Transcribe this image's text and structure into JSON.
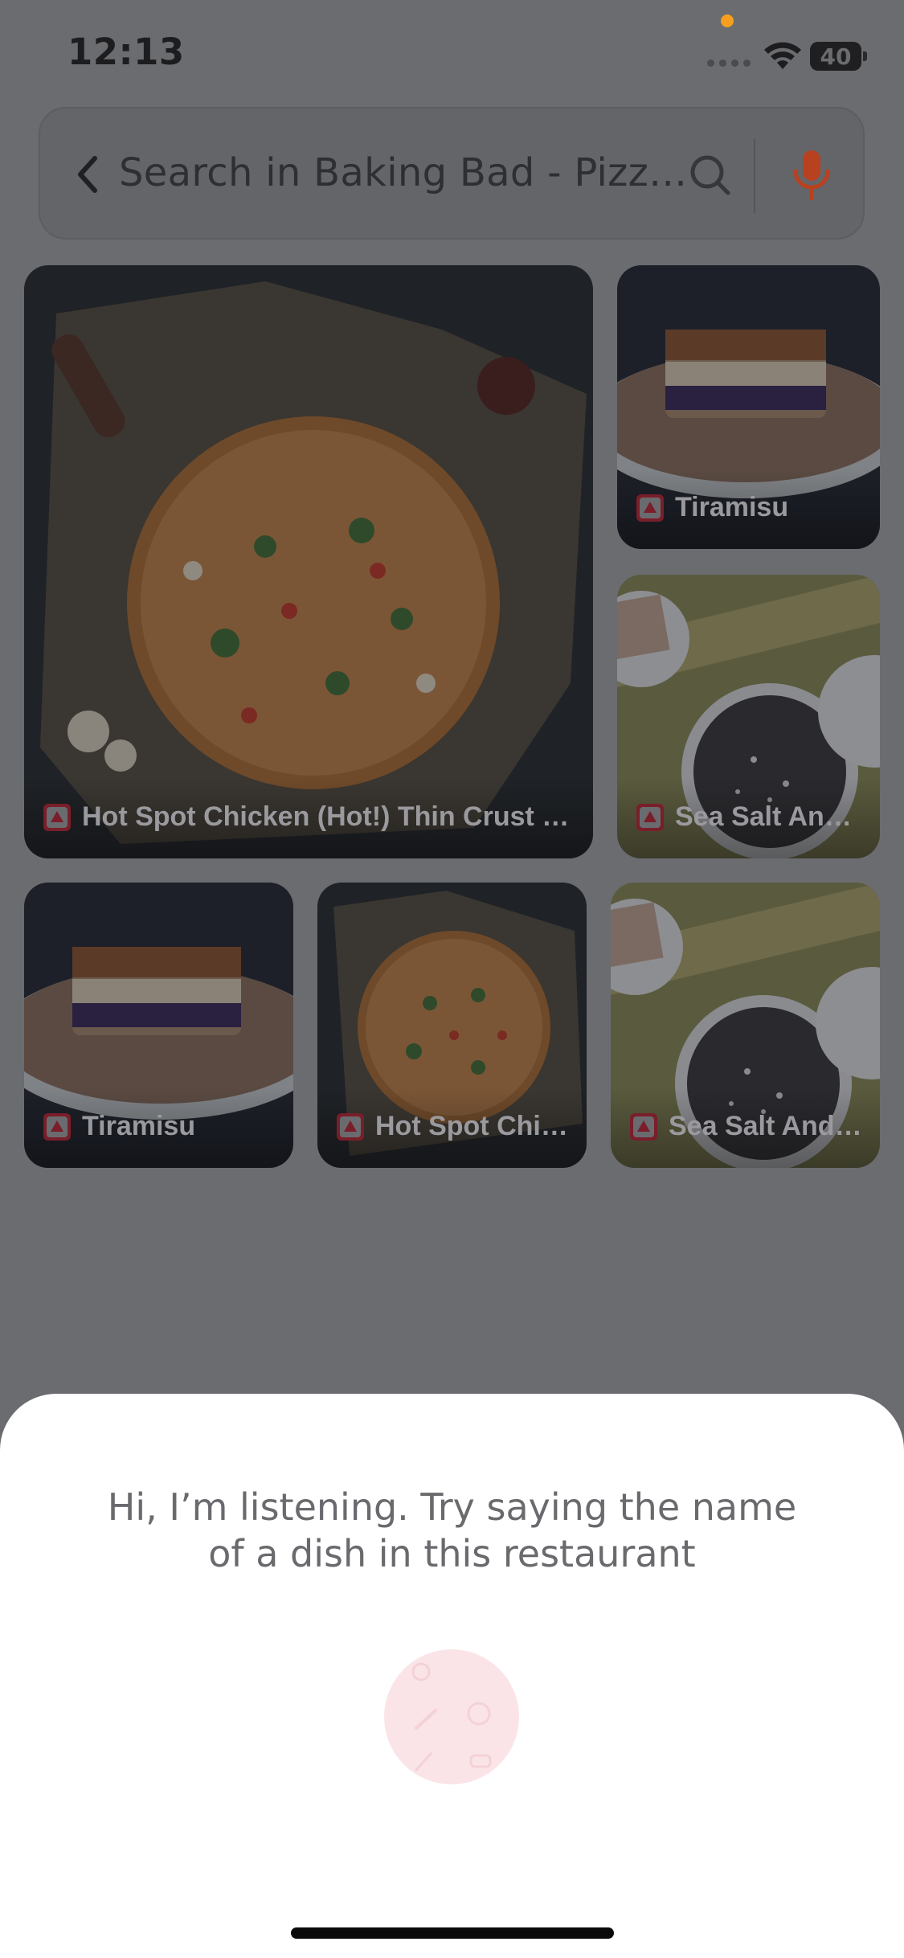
{
  "status_bar": {
    "time": "12:13",
    "battery_level": "40",
    "privacy_dot_color": "#f59f1d",
    "icons": [
      "signal-icon",
      "wifi-icon",
      "battery-icon"
    ]
  },
  "search": {
    "value": "Search in Baking Bad - Pizza...",
    "back_icon": "chevron-left-icon",
    "search_icon": "search-icon",
    "mic_icon": "mic-icon",
    "mic_color": "#b8421f"
  },
  "dishes": [
    {
      "name": "Hot Spot Chicken (Hot!) Thin Crust Pizza",
      "photo": "pizza"
    },
    {
      "name": "Tiramisu",
      "photo": "tiramisu"
    },
    {
      "name": "Sea Salt And D...",
      "photo": "cookie-tins"
    },
    {
      "name": "Tiramisu",
      "photo": "tiramisu"
    },
    {
      "name": "Hot Spot Chick...",
      "photo": "pizza"
    },
    {
      "name": "Sea Salt And D...",
      "photo": "cookie-tins"
    }
  ],
  "voice_sheet": {
    "prompt_line1": "Hi, I’m listening. Try saying the name",
    "prompt_line2": "of a dish in this restaurant",
    "orb_color": "#fbe4e7"
  }
}
